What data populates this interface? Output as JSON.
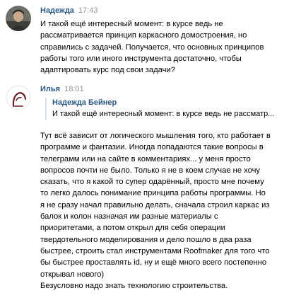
{
  "messages": [
    {
      "author": "Надежда",
      "time": "17:43",
      "lines": [
        "И такой ещё интересный момент: в курсе ведь не",
        "рассматривается принцип каркасного домостроения, но",
        "справились с задачей. Получается, что основных принципов",
        "работы того или иного инструмента достаточно, чтобы",
        "адаптировать курс под свои задачи?"
      ]
    },
    {
      "author": "Илья",
      "time": "18:01",
      "reply": {
        "author": "Надежда Бейнер",
        "text": "И такой ещё интересный момент: в курсе ведь не рассматр..."
      },
      "lines": [
        "Тут всё зависит от логического мышления того, кто работает в",
        "программе и фантазии. Иногда попадаются такие вопросы в",
        "телеграмм или на сайте в комментариях... у меня просто",
        "вопросов почти не было. Только я не в коем случае не хочу",
        "сказать, что я какой то супер одарённый, просто мне почему",
        "то легко далось понимание принципа работы программы. Но",
        "я не сразу начал правильно делать, сначала строил каркас из",
        "балок и колон назначая им разные материалы с",
        "приоритетами, а потом открыл для себя операции",
        "твердотельного моделирования и дело пошло в два раза",
        "быстрее, строить стал инструментами Roofmaker для того что",
        "бы быстрее проставлять id, ну и ещё много всего постепенно",
        "открывал нового)",
        "Безусловно надо знать технологию строительства."
      ]
    }
  ]
}
